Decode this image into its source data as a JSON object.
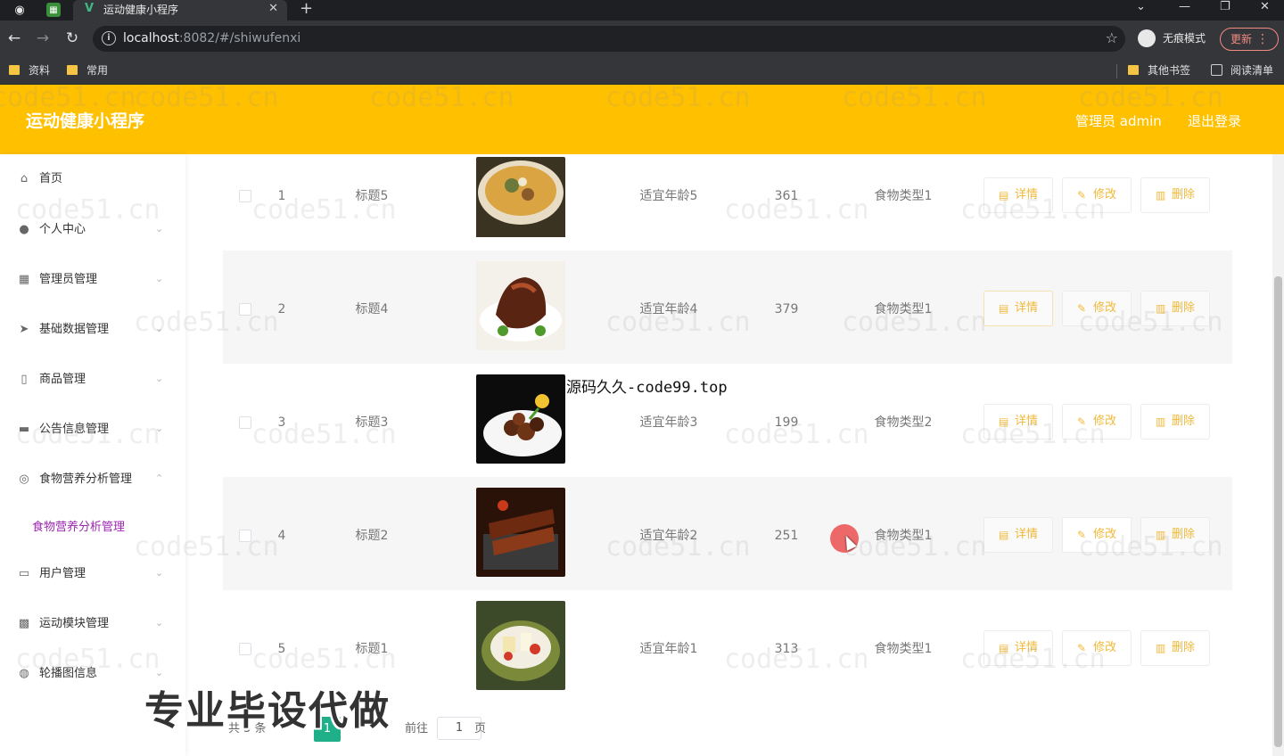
{
  "browser": {
    "tab_title": "运动健康小程序",
    "tab_favicon": "V",
    "url_host": "localhost",
    "url_rest": ":8082/#/shiwufenxi",
    "incognito_label": "无痕模式",
    "update_label": "更新",
    "bookmarks": [
      "资料",
      "常用"
    ],
    "bookmarks_right": [
      "其他书签",
      "阅读清单"
    ]
  },
  "header": {
    "title": "运动健康小程序",
    "user_label": "管理员 admin",
    "logout_label": "退出登录",
    "accent_color": "#ffc000"
  },
  "sidebar": {
    "items": [
      {
        "label": "首页",
        "icon": "home-icon"
      },
      {
        "label": "个人中心",
        "icon": "user-icon"
      },
      {
        "label": "管理员管理",
        "icon": "grid-icon"
      },
      {
        "label": "基础数据管理",
        "icon": "send-icon"
      },
      {
        "label": "商品管理",
        "icon": "phone-icon"
      },
      {
        "label": "公告信息管理",
        "icon": "briefcase-icon"
      },
      {
        "label": "食物营养分析管理",
        "icon": "compass-icon"
      },
      {
        "label": "用户管理",
        "icon": "chat-icon"
      },
      {
        "label": "运动模块管理",
        "icon": "apps-icon"
      },
      {
        "label": "轮播图信息",
        "icon": "mic-icon"
      }
    ],
    "active_sub": "食物营养分析管理",
    "active_color": "#9c27b0"
  },
  "table": {
    "rows": [
      {
        "index": "1",
        "title": "标题5",
        "age": "适宜年龄5",
        "value": "361",
        "type": "食物类型1"
      },
      {
        "index": "2",
        "title": "标题4",
        "age": "适宜年龄4",
        "value": "379",
        "type": "食物类型1"
      },
      {
        "index": "3",
        "title": "标题3",
        "age": "适宜年龄3",
        "value": "199",
        "type": "食物类型2"
      },
      {
        "index": "4",
        "title": "标题2",
        "age": "适宜年龄2",
        "value": "251",
        "type": "食物类型1"
      },
      {
        "index": "5",
        "title": "标题1",
        "age": "适宜年龄1",
        "value": "313",
        "type": "食物类型1"
      }
    ],
    "actions": {
      "detail": "详情",
      "edit": "修改",
      "delete": "删除"
    }
  },
  "pagination": {
    "total_label": "共 5 条",
    "current_page": "1",
    "goto_label": "前往",
    "goto_value": "1",
    "page_unit": "页"
  },
  "overlays": {
    "watermark": "code51.cn",
    "source_text": "源码久久-code99.top",
    "ad_text": "专业毕设代做"
  }
}
